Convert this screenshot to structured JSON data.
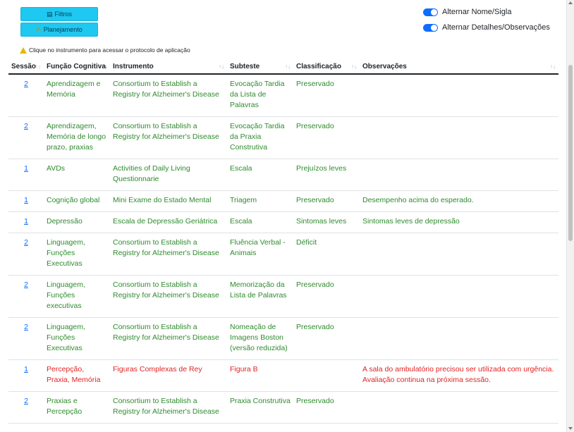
{
  "buttons": {
    "filtros": "Filtros",
    "planejamento": "Planejamento"
  },
  "toggles": [
    {
      "label": "Alternar Nome/Sigla",
      "on": true
    },
    {
      "label": "Alternar Detalhes/Observações",
      "on": true
    }
  ],
  "hint": "Clique no instrumento para acessar o protocolo de aplicação",
  "table": {
    "headers": [
      "Sessão",
      "Função Cognitiva",
      "Instrumento",
      "Subteste",
      "Classificação",
      "Observações"
    ],
    "rows": [
      {
        "sessao": "2",
        "funcao": "Aprendizagem e Memória",
        "instrumento": "Consortium to Establish a Registry for Alzheimer's Disease",
        "subteste": "Evocação Tardia da Lista de Palavras",
        "classificacao": "Preservado",
        "observacoes": ""
      },
      {
        "sessao": "2",
        "funcao": "Aprendizagem, Memória de longo prazo, praxias",
        "instrumento": "Consortium to Establish a Registry for Alzheimer's Disease",
        "subteste": "Evocação Tardia da Praxia Construtiva",
        "classificacao": "Preservado",
        "observacoes": ""
      },
      {
        "sessao": "1",
        "funcao": "AVDs",
        "instrumento": "Activities of Daily Living Questionnarie",
        "subteste": "Escala",
        "classificacao": "Prejuízos leves",
        "observacoes": ""
      },
      {
        "sessao": "1",
        "funcao": "Cognição global",
        "instrumento": "Mini Exame do Estado Mental",
        "subteste": "Triagem",
        "classificacao": "Preservado",
        "observacoes": "Desempenho acima do esperado."
      },
      {
        "sessao": "1",
        "funcao": "Depressão",
        "instrumento": "Escala de Depressão Geriátrica",
        "subteste": "Escala",
        "classificacao": "Sintomas leves",
        "observacoes": "Sintomas leves de depressão"
      },
      {
        "sessao": "2",
        "funcao": "Linguagem, Funções Executivas",
        "instrumento": "Consortium to Establish a Registry for Alzheimer's Disease",
        "subteste": "Fluência Verbal - Animais",
        "classificacao": "Déficit",
        "observacoes": ""
      },
      {
        "sessao": "2",
        "funcao": "Linguagem, Funções executivas",
        "instrumento": "Consortium to Establish a Registry for Alzheimer's Disease",
        "subteste": "Memorização da Lista de Palavras",
        "classificacao": "Preservado",
        "observacoes": ""
      },
      {
        "sessao": "2",
        "funcao": "Linguagem, Funções Executivas",
        "instrumento": "Consortium to Establish a Registry for Alzheimer's Disease",
        "subteste": "Nomeação de Imagens Boston (versão reduzida)",
        "classificacao": "Preservado",
        "observacoes": ""
      },
      {
        "sessao": "1",
        "funcao": "Percepção, Praxia, Memória",
        "instrumento": "Figuras Complexas de Rey",
        "subteste": "Figura B",
        "classificacao": "",
        "observacoes": "A sala do ambulatório precisou ser utilizada com urgência. Avaliação continua na próxima sessão.",
        "highlight": true
      },
      {
        "sessao": "2",
        "funcao": "Praxias e Percepção",
        "instrumento": "Consortium to Establish a Registry for Alzheimer's Disease",
        "subteste": "Praxia Construtiva",
        "classificacao": "Preservado",
        "observacoes": ""
      }
    ]
  },
  "colors": {
    "button": "#1ec8f0",
    "toggle": "#0d6efd",
    "ok_text": "#2e8b2e",
    "alert_text": "#e02424",
    "link": "#0d6efd"
  }
}
